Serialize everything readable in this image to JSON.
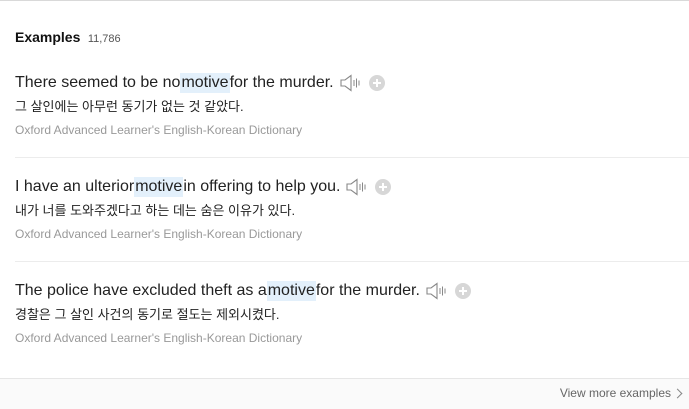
{
  "header": {
    "title": "Examples",
    "count": "11,786"
  },
  "examples": [
    {
      "before": "There seemed to be no ",
      "keyword": "motive",
      "after": " for the murder.",
      "translation": "그 살인에는 아무런 동기가 없는 것 같았다.",
      "source": "Oxford Advanced Learner's English-Korean Dictionary"
    },
    {
      "before": "I have an ulterior ",
      "keyword": "motive",
      "after": " in offering to help you.",
      "translation": "내가 너를 도와주겠다고 하는 데는 숨은 이유가 있다.",
      "source": "Oxford Advanced Learner's English-Korean Dictionary"
    },
    {
      "before": "The police have excluded theft as a ",
      "keyword": "motive",
      "after": " for the murder.",
      "translation": "경찰은 그 살인 사건의 동기로 절도는 제외시켰다.",
      "source": "Oxford Advanced Learner's English-Korean Dictionary"
    }
  ],
  "footer": {
    "more_label": "View more examples"
  },
  "icons": {
    "speaker": "speaker-icon",
    "add": "plus-circle-icon"
  },
  "colors": {
    "highlight": "#e3f0fb",
    "source_text": "#999999"
  }
}
